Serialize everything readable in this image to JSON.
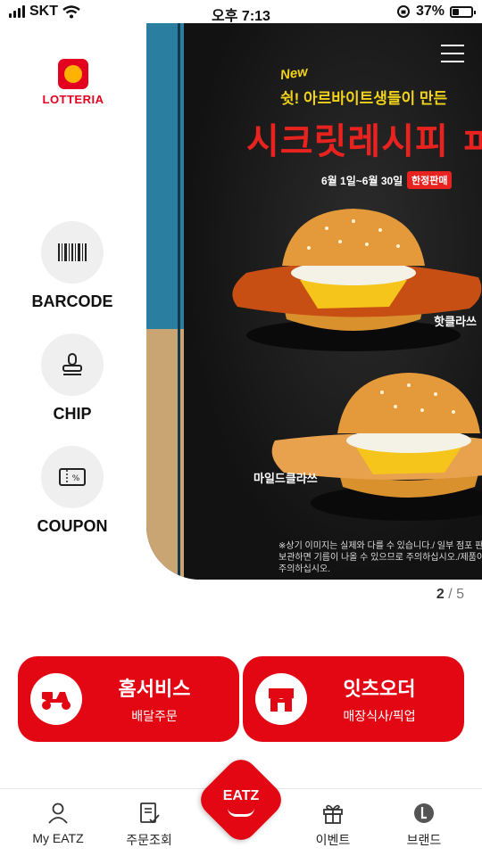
{
  "status_bar": {
    "carrier": "SKT",
    "time": "오후 7:13",
    "battery": "37%",
    "battery_level": 0.37
  },
  "brand": {
    "logo_text": "LOTTERIA"
  },
  "side_menu": [
    {
      "label": "BARCODE",
      "icon": "barcode-icon"
    },
    {
      "label": "CHIP",
      "icon": "stamp-icon"
    },
    {
      "label": "COUPON",
      "icon": "coupon-icon"
    }
  ],
  "banner": {
    "new_badge": "New",
    "subtitle": "쉿! 아르바이트생들이 만든",
    "title": "시크릿레시피 ㅍ",
    "date": "6월 1일~6월 30일",
    "limited": "한정판매",
    "burger_1": "핫클라쓰",
    "burger_2": "마일드클라쓰",
    "disclaimer_1": "※상기 이미지는 실제와 다를 수 있습니다./ 일부 점포 판매 제외 / 장시",
    "disclaimer_2": "보관하면 기름이 나올 수 있으므로 주의하십시오./제품이 뜨거울 수 있으",
    "disclaimer_3": "주의하십시오.",
    "menu_icon": "hamburger-menu-icon"
  },
  "pager": {
    "current": "2",
    "separator": "/",
    "total": "5"
  },
  "actions": [
    {
      "title": "홈서비스",
      "subtitle": "배달주문",
      "icon": "scooter-icon"
    },
    {
      "title": "잇츠오더",
      "subtitle": "매장식사/픽업",
      "icon": "store-icon"
    }
  ],
  "bottom_nav": {
    "items": [
      {
        "label": "My EATZ",
        "icon": "user-icon"
      },
      {
        "label": "주문조회",
        "icon": "order-list-icon"
      },
      {
        "label": "이벤트",
        "icon": "gift-icon"
      },
      {
        "label": "브랜드",
        "icon": "brand-icon"
      }
    ],
    "center_label": "EATZ"
  },
  "colors": {
    "brand_red": "#e30613",
    "poster_title": "#e8231f",
    "poster_yellow": "#f2d21b"
  }
}
